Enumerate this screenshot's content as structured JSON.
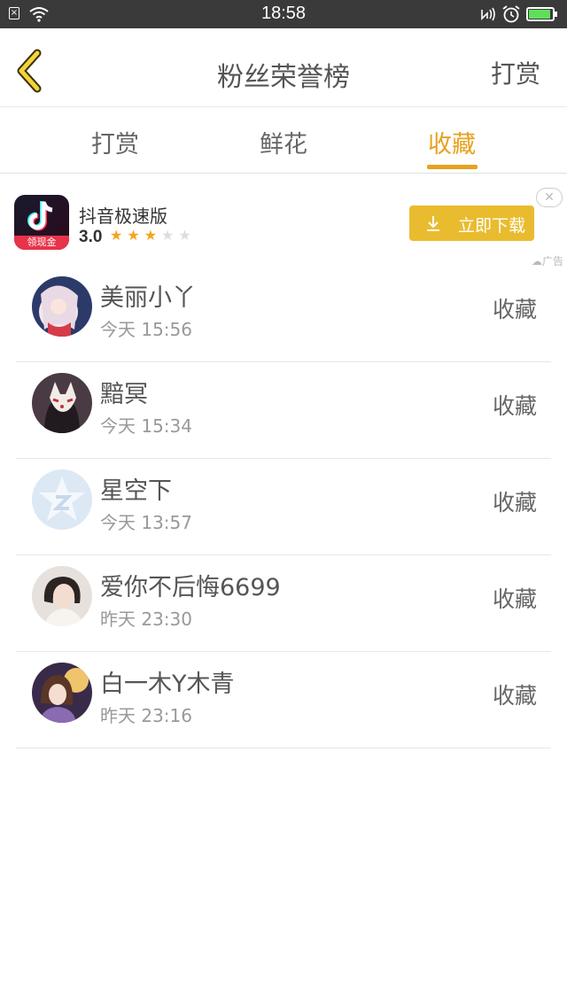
{
  "status_bar": {
    "time": "18:58"
  },
  "header": {
    "title": "粉丝荣誉榜",
    "action_label": "打赏"
  },
  "tabs": [
    {
      "label": "打赏"
    },
    {
      "label": "鲜花"
    },
    {
      "label": "收藏"
    }
  ],
  "active_tab": "收藏",
  "accent_color": "#e6a21f",
  "ad": {
    "app_name": "抖音极速版",
    "icon_tag": "领现金",
    "rating": "3.0",
    "rating_value": 3,
    "rating_max": 5,
    "button_label": "立即下载",
    "ad_label": "广告",
    "close_symbol": "✕"
  },
  "rows": [
    {
      "name": "美丽小丫",
      "time": "今天 15:56",
      "action": "收藏"
    },
    {
      "name": "黯冥",
      "time": "今天 15:34",
      "action": "收藏"
    },
    {
      "name": "星空下",
      "time": "今天 13:57",
      "action": "收藏"
    },
    {
      "name": "爱你不后悔6699",
      "time": "昨天 23:30",
      "action": "收藏"
    },
    {
      "name": "白一木Y木青",
      "time": "昨天 23:16",
      "action": "收藏"
    }
  ]
}
